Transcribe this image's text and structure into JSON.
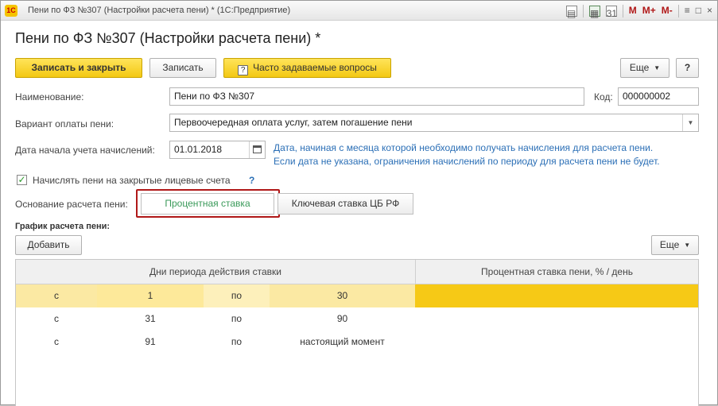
{
  "window": {
    "app_icon": "1C",
    "title": "Пени по ФЗ №307 (Настройки расчета пени) * (1С:Предприятие)",
    "toolbar_icons": [
      "print-icon",
      "calculator-icon",
      "calendar-icon"
    ],
    "memory_buttons": [
      "M",
      "M+",
      "M-"
    ],
    "menu_symbol": "≡",
    "restore_symbol": "□",
    "close_symbol": "×"
  },
  "form": {
    "title": "Пени по ФЗ №307 (Настройки расчета пени) *",
    "toolbar": {
      "save_close": "Записать и закрыть",
      "save": "Записать",
      "faq": "Часто задаваемые вопросы",
      "more": "Еще",
      "help": "?"
    },
    "name_label": "Наименование:",
    "name_value": "Пени по ФЗ №307",
    "code_label": "Код:",
    "code_value": "000000002",
    "payment_label": "Вариант оплаты пени:",
    "payment_value": "Первоочередная оплата услуг, затем погашение пени",
    "date_label": "Дата начала учета начислений:",
    "date_value": "01.01.2018",
    "date_hint_1": "Дата, начиная с месяца которой необходимо получать начисления для расчета пени.",
    "date_hint_2": "Если дата не указана, ограничения начислений по периоду для расчета пени не будет.",
    "closed_accounts_label": "Начислять пени на закрытые лицевые счета",
    "closed_accounts_checked": true,
    "help_mark": "?",
    "basis_label": "Основание расчета пени:",
    "basis_options": [
      "Процентная ставка",
      "Ключевая ставка ЦБ РФ"
    ],
    "basis_selected": "Процентная ставка",
    "schedule_title": "График расчета пени:",
    "add_button": "Добавить",
    "table_more": "Еще"
  },
  "table": {
    "columns": [
      "Дни периода действия ставки",
      "Процентная ставка пени, % / день"
    ],
    "rows": [
      {
        "from_prefix": "с",
        "from": "1",
        "to_prefix": "по",
        "to": "30",
        "rate": ""
      },
      {
        "from_prefix": "с",
        "from": "31",
        "to_prefix": "по",
        "to": "90",
        "rate": ""
      },
      {
        "from_prefix": "с",
        "from": "91",
        "to_prefix": "по",
        "to": "настоящий момент",
        "rate": ""
      }
    ],
    "selected_row": 0
  },
  "colors": {
    "accent_yellow": "#f3c813",
    "selection": "#fbe9a3",
    "hint_blue": "#2b6fb6",
    "highlight_red": "#b01818",
    "radio_green": "#3a9a5a"
  }
}
